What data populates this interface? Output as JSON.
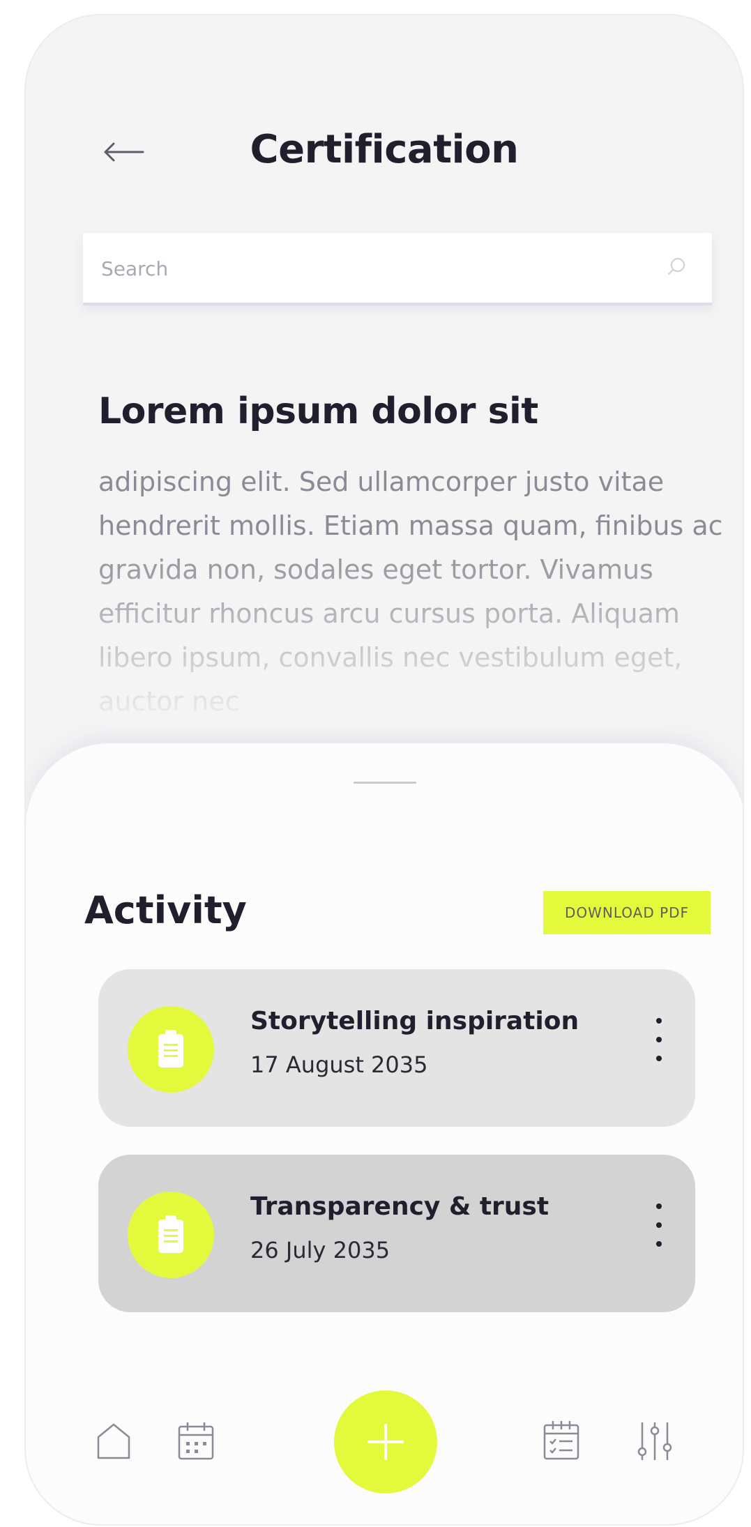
{
  "header": {
    "title": "Certification",
    "back_icon": "arrow-left-icon"
  },
  "search": {
    "placeholder": "Search",
    "value": "",
    "icon": "search-icon"
  },
  "intro": {
    "heading": "Lorem ipsum dolor sit",
    "body": "adipiscing elit. Sed ullamcorper justo vitae hendrerit mollis. Etiam massa quam, finibus ac gravida non, sodales eget tortor. Vivamus efficitur rhoncus arcu cursus porta. Aliquam libero ipsum, convallis nec vestibulum eget, auctor nec"
  },
  "activity": {
    "title": "Activity",
    "download_label": "DOWNLOAD PDF",
    "items": [
      {
        "title": "Storytelling inspiration",
        "date": "17 August 2035",
        "icon": "clipboard-icon"
      },
      {
        "title": "Transparency & trust",
        "date": "26 July 2035",
        "icon": "clipboard-icon"
      }
    ]
  },
  "nav": {
    "items": [
      "home-icon",
      "calendar-icon",
      "add-icon",
      "task-calendar-icon",
      "filters-icon"
    ]
  },
  "colors": {
    "accent": "#e3fa3c",
    "background": "#f4f4f5",
    "text": "#1f1f2e"
  }
}
